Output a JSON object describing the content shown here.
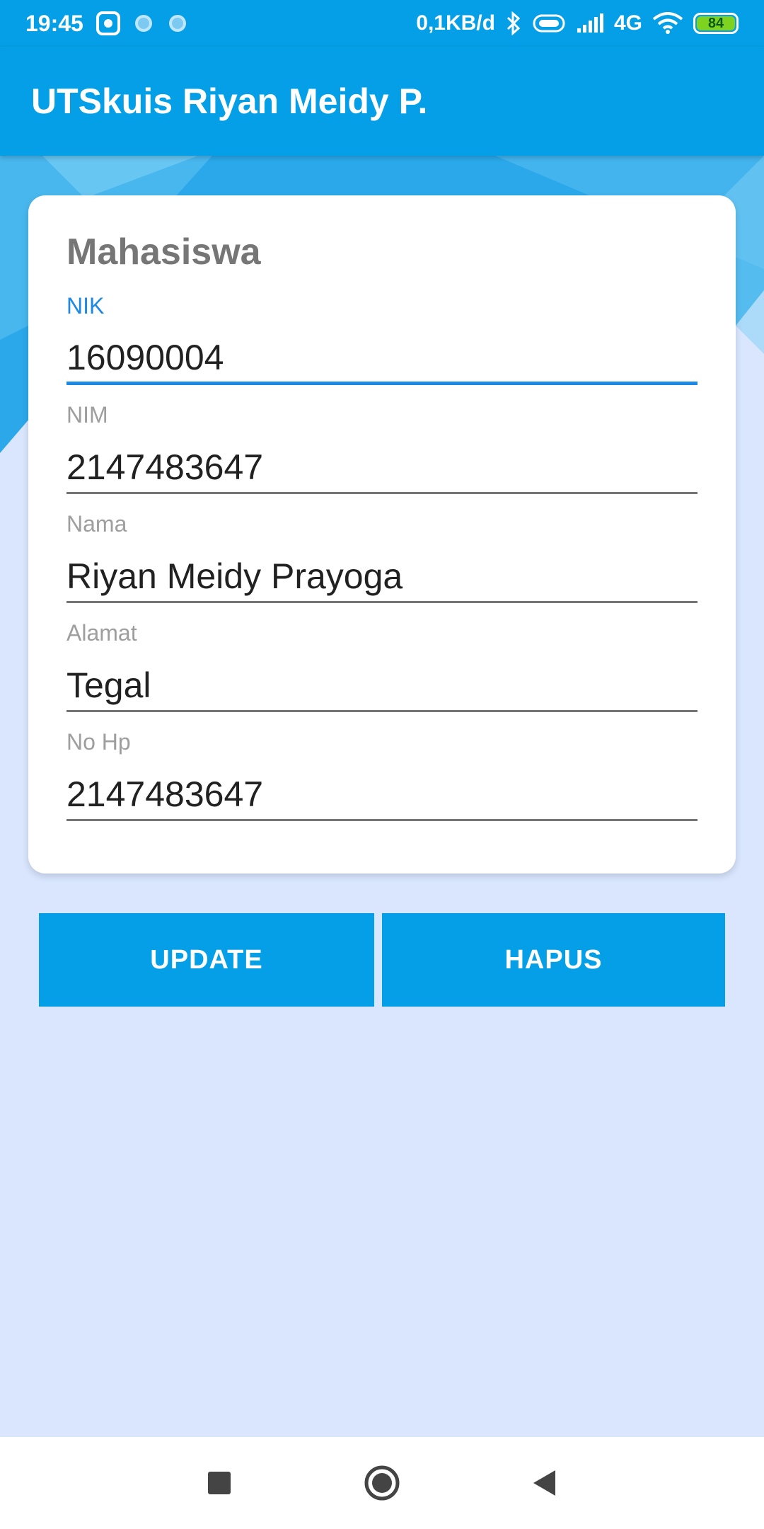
{
  "status_bar": {
    "time": "19:45",
    "network_speed": "0,1KB/d",
    "network_type": "4G",
    "battery": "84",
    "icons": [
      "screen-record-icon",
      "notification-dot-icon",
      "notification-dot-icon",
      "bluetooth-icon",
      "vibrate-icon",
      "signal-icon",
      "wifi-icon",
      "battery-icon"
    ]
  },
  "app_bar": {
    "title": "UTSkuis Riyan Meidy P."
  },
  "card": {
    "title": "Mahasiswa",
    "fields": [
      {
        "label": "NIK",
        "value": "16090004",
        "focused": true
      },
      {
        "label": "NIM",
        "value": "2147483647"
      },
      {
        "label": "Nama",
        "value": "Riyan Meidy Prayoga"
      },
      {
        "label": "Alamat",
        "value": "Tegal"
      },
      {
        "label": "No Hp",
        "value": "2147483647"
      }
    ]
  },
  "buttons": {
    "update_label": "UPDATE",
    "hapus_label": "HAPUS"
  },
  "nav_bar": {
    "icons": [
      "recents-icon",
      "home-icon",
      "back-icon"
    ]
  },
  "colors": {
    "primary": "#049fe6",
    "accent": "#1e88e5",
    "background": "#d9e6fe"
  }
}
